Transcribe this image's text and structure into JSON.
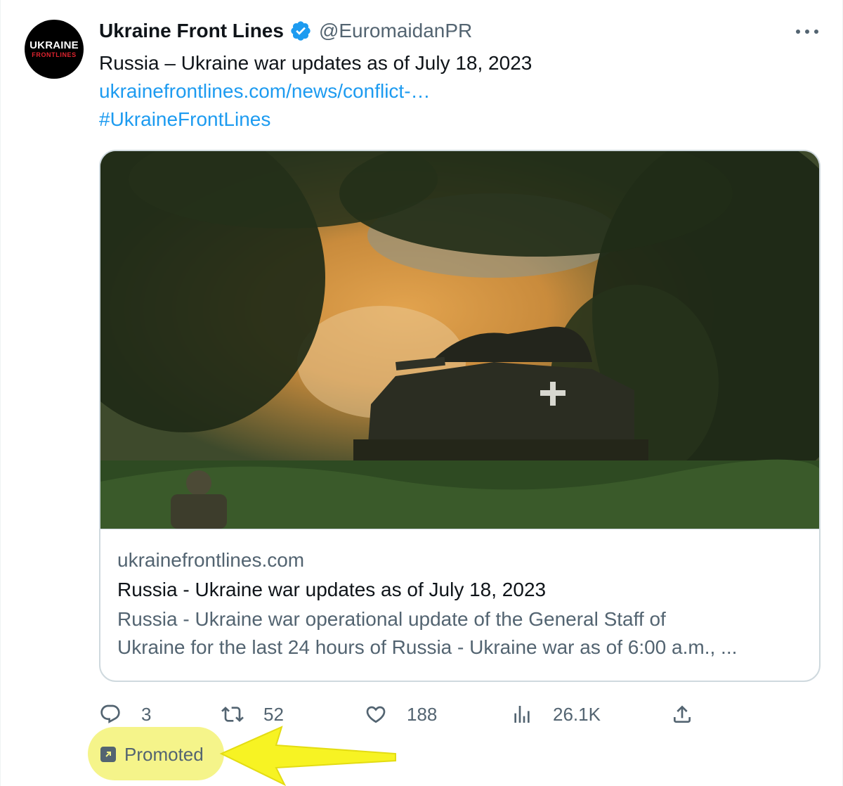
{
  "tweet": {
    "avatar": {
      "line1": "UKRAINE",
      "line2": "FRONTLINES"
    },
    "author_name": "Ukraine Front Lines",
    "handle": "@EuromaidanPR",
    "verified_icon": "verified-badge-icon",
    "text": "Russia – Ukraine war updates as of July 18, 2023",
    "link": "ukrainefrontlines.com/news/conflict-…",
    "hashtag": "#UkraineFrontLines"
  },
  "card": {
    "domain": "ukrainefrontlines.com",
    "title": "Russia - Ukraine war updates as of July 18, 2023",
    "description_line1": "Russia - Ukraine war operational update of the General Staff of",
    "description_line2": "Ukraine for the last 24 hours of Russia - Ukraine war as of 6:00 a.m., ..."
  },
  "actions": {
    "replies": "3",
    "retweets": "52",
    "likes": "188",
    "views": "26.1K"
  },
  "promoted": {
    "label": "Promoted"
  },
  "colors": {
    "accent": "#1d9bf0",
    "secondary_text": "#536471",
    "highlight": "#f5f48a"
  }
}
